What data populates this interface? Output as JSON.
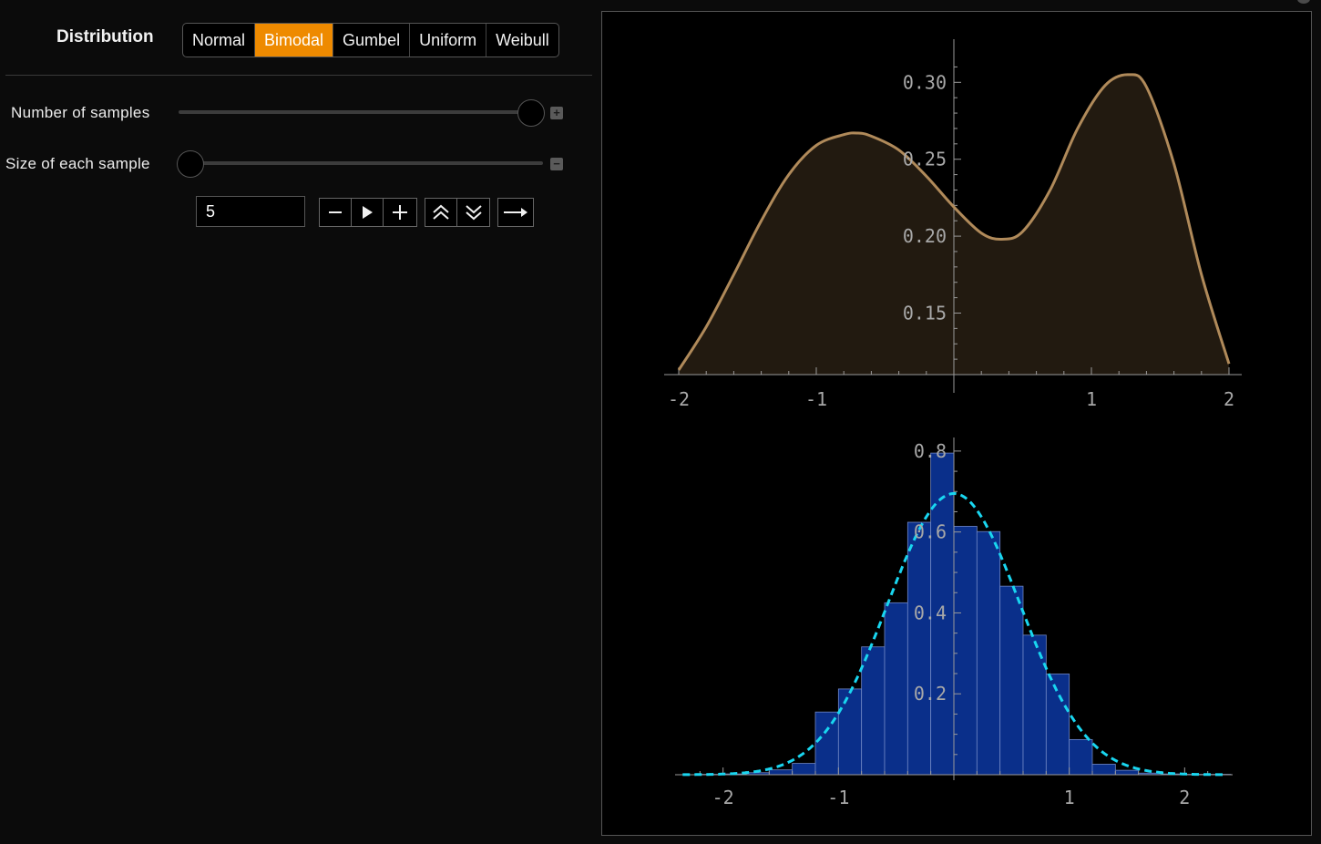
{
  "controls": {
    "distribution_label": "Distribution",
    "distribution_options": [
      "Normal",
      "Bimodal",
      "Gumbel",
      "Uniform",
      "Weibull"
    ],
    "selected_distribution": "Bimodal",
    "num_samples_label": "Number of samples",
    "num_samples_slider_fraction": 1.0,
    "sample_size_label": "Size of each sample",
    "sample_size_slider_fraction": 0.0,
    "sample_size_value": "5",
    "expand_icon": "plus-square-icon",
    "collapse_icon": "minus-square-icon"
  },
  "animator": {
    "buttons": [
      "minus-icon",
      "play-icon",
      "plus-icon",
      "faster-icon",
      "slower-icon",
      "direction-arrow-icon"
    ]
  },
  "colors": {
    "accent": "#ee8a00",
    "density_line": "#b08a5a",
    "density_fill": "#221a10",
    "histogram_fill": "#0a2f8a",
    "fit_curve": "#19d6f0",
    "axis_text": "#a8a8a8"
  },
  "chart_data": [
    {
      "type": "area",
      "xlim": [
        -2,
        2
      ],
      "ylim": [
        0.11,
        0.315
      ],
      "x_ticks": [
        -2,
        -1,
        1,
        2
      ],
      "x_tick_labels": [
        "-2",
        "-1",
        "1",
        "2"
      ],
      "y_ticks": [
        0.15,
        0.2,
        0.25,
        0.3
      ],
      "y_tick_labels": [
        "0.15",
        "0.20",
        "0.25",
        "0.30"
      ],
      "x": [
        -2.0,
        -1.8,
        -1.6,
        -1.4,
        -1.2,
        -1.0,
        -0.8,
        -0.7,
        -0.6,
        -0.4,
        -0.2,
        0.0,
        0.2,
        0.35,
        0.5,
        0.7,
        0.9,
        1.1,
        1.27,
        1.4,
        1.6,
        1.8,
        2.0
      ],
      "y": [
        0.113,
        0.141,
        0.175,
        0.21,
        0.24,
        0.259,
        0.266,
        0.267,
        0.265,
        0.256,
        0.239,
        0.219,
        0.202,
        0.198,
        0.203,
        0.23,
        0.27,
        0.298,
        0.305,
        0.297,
        0.247,
        0.175,
        0.117
      ]
    },
    {
      "type": "bar",
      "xlim": [
        -2.4,
        2.4
      ],
      "ylim": [
        0,
        0.82
      ],
      "x_ticks": [
        -2,
        -1,
        1,
        2
      ],
      "x_tick_labels": [
        "-2",
        "-1",
        "1",
        "2"
      ],
      "y_ticks": [
        0.2,
        0.4,
        0.6,
        0.8
      ],
      "y_tick_labels": [
        "0.2",
        "0.4",
        "0.6",
        "0.8"
      ],
      "bin_width": 0.2,
      "bin_starts": [
        -2.2,
        -2.0,
        -1.8,
        -1.6,
        -1.4,
        -1.2,
        -1.0,
        -0.8,
        -0.6,
        -0.4,
        -0.2,
        0.0,
        0.2,
        0.4,
        0.6,
        0.8,
        1.0,
        1.2,
        1.4,
        1.6,
        1.8,
        2.0,
        2.2
      ],
      "values": [
        0.001,
        0.002,
        0.005,
        0.012,
        0.028,
        0.155,
        0.212,
        0.316,
        0.425,
        0.624,
        0.795,
        0.614,
        0.601,
        0.466,
        0.345,
        0.249,
        0.087,
        0.026,
        0.011,
        0.004,
        0.002,
        0.001,
        0.001
      ],
      "fit_curve": {
        "style": "dashed",
        "mean": 0.0,
        "sd": 0.574,
        "peak": 0.695
      }
    }
  ]
}
